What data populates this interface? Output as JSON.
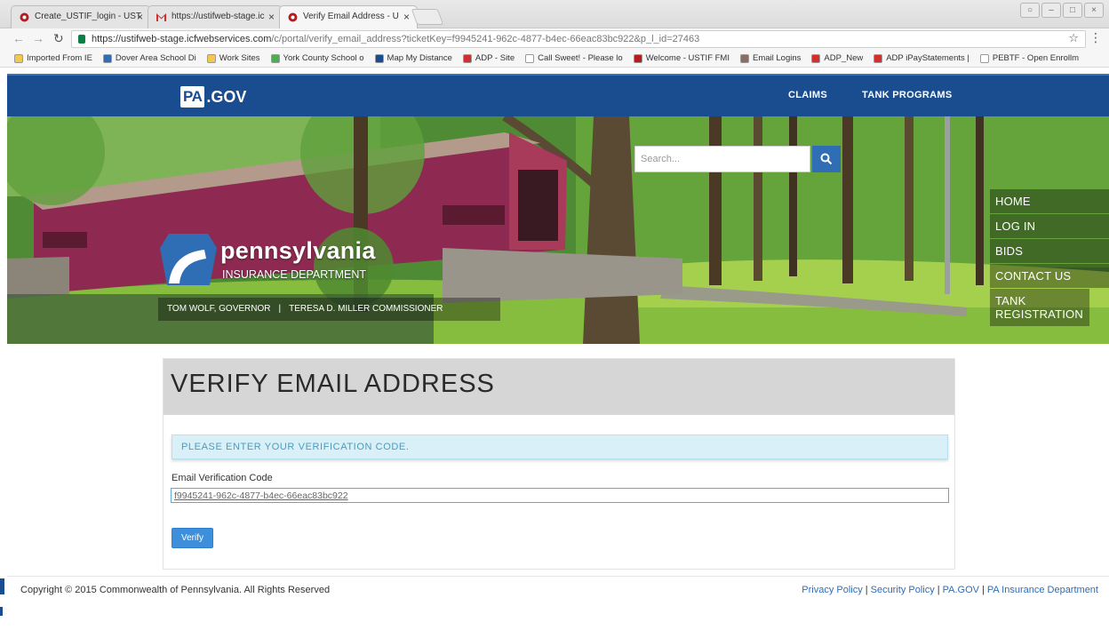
{
  "browser": {
    "tabs": [
      {
        "title": "Create_USTIF_login - UST",
        "active": false
      },
      {
        "title": "https://ustifweb-stage.ic",
        "active": false
      },
      {
        "title": "Verify Email Address - U",
        "active": true
      }
    ],
    "url_main": "https://ustifweb-stage.icfwebservices.com",
    "url_path": "/c/portal/verify_email_address?ticketKey=f9945241-962c-4877-b4ec-66eac83bc922&p_l_id=27463",
    "bookmarks": [
      {
        "label": "Imported From IE",
        "color": "#f2c94c"
      },
      {
        "label": "Dover Area School Di",
        "color": "#2f6db5"
      },
      {
        "label": "Work Sites",
        "color": "#f2c94c"
      },
      {
        "label": "York County School o",
        "color": "#4caf50"
      },
      {
        "label": "Map My Distance",
        "color": "#1a4d8f"
      },
      {
        "label": "ADP - Site",
        "color": "#d32f2f"
      },
      {
        "label": "Call Sweet! - Please lo",
        "color": "#ffffff"
      },
      {
        "label": "Welcome - USTIF FMI",
        "color": "#b71c1c"
      },
      {
        "label": "Email Logins",
        "color": "#8d6e63"
      },
      {
        "label": "ADP_New",
        "color": "#d32f2f"
      },
      {
        "label": "ADP iPayStatements |",
        "color": "#d32f2f"
      },
      {
        "label": "PEBTF - Open Enrollm",
        "color": "#ffffff"
      }
    ]
  },
  "header": {
    "logo_pa": "PA",
    "logo_gov": ".GOV",
    "nav": [
      {
        "label": "CLAIMS"
      },
      {
        "label": "TANK PROGRAMS"
      }
    ]
  },
  "hero": {
    "search_placeholder": "Search...",
    "brand_name": "pennsylvania",
    "brand_sub": "INSURANCE DEPARTMENT",
    "governor": "TOM WOLF, GOVERNOR",
    "separator": "|",
    "commissioner": "TERESA D. MILLER COMMISSIONER",
    "sidenav": [
      "HOME",
      "LOG IN",
      "BIDS",
      "CONTACT US",
      "TANK REGISTRATION"
    ]
  },
  "card": {
    "title": "VERIFY EMAIL ADDRESS",
    "alert": "PLEASE ENTER YOUR VERIFICATION CODE.",
    "field_label": "Email Verification Code",
    "field_value": "f9945241-962c-4877-b4ec-66eac83bc922",
    "button": "Verify"
  },
  "footer": {
    "copyright": "Copyright © 2015 Commonwealth of Pennsylvania. All Rights Reserved",
    "links": [
      "Privacy Policy",
      "Security Policy",
      "PA.GOV",
      "PA Insurance Department"
    ],
    "pipe": "|"
  }
}
